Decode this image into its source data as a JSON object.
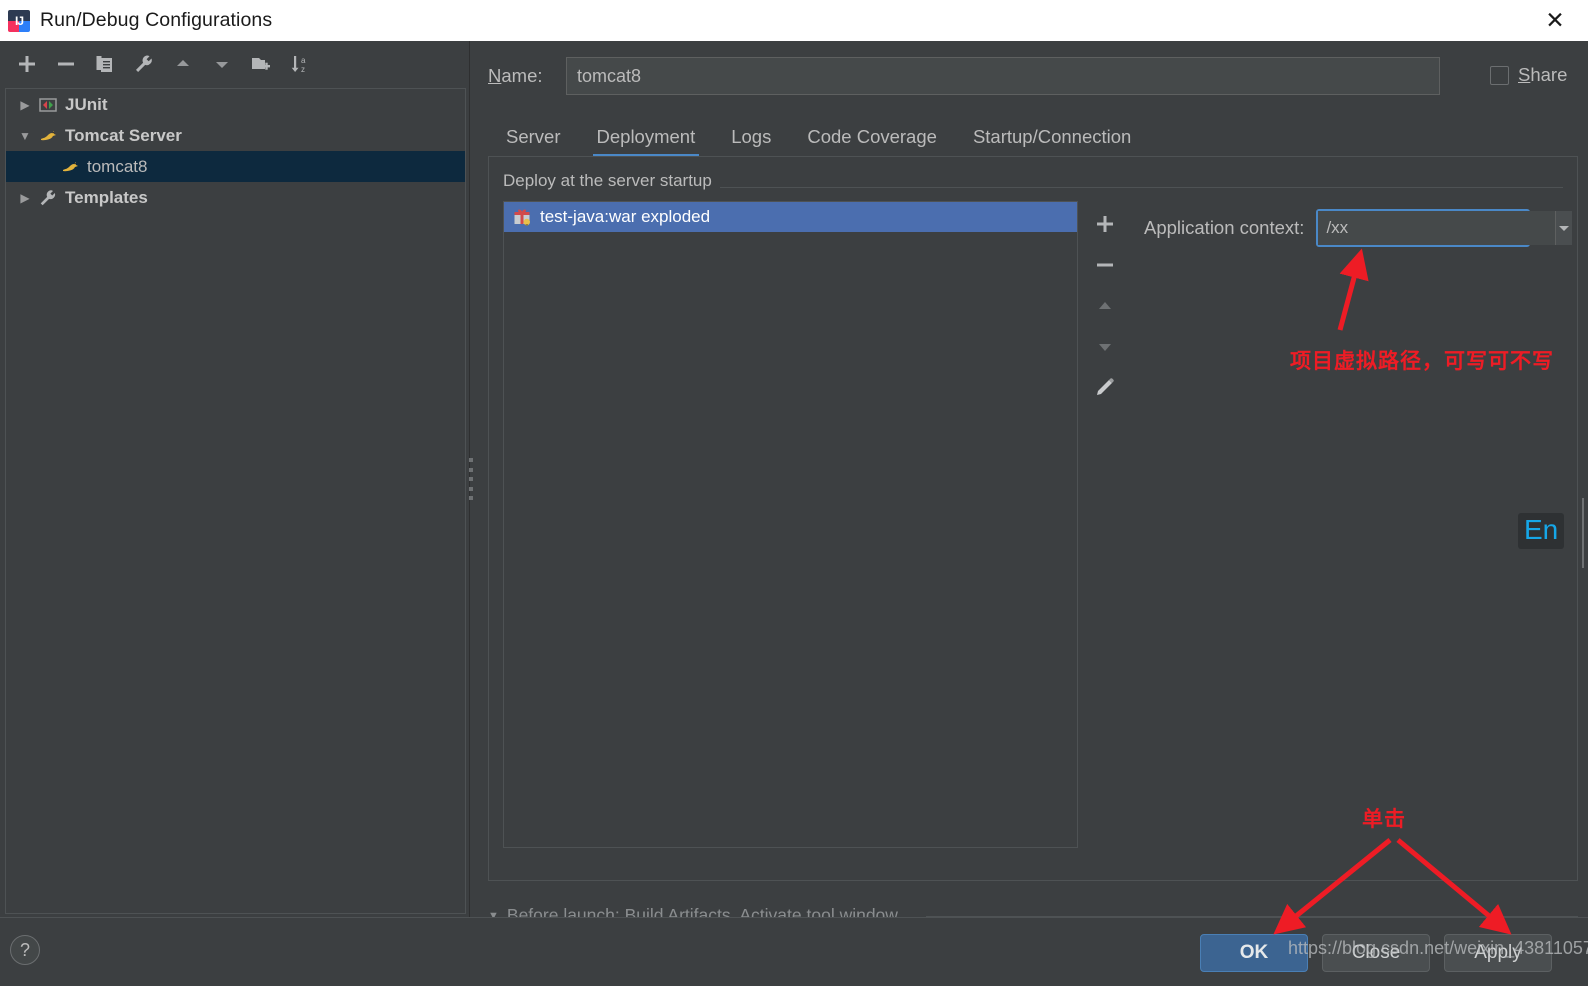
{
  "window": {
    "title": "Run/Debug Configurations",
    "app_icon": "intellij-idea-icon",
    "close_icon": "close-icon"
  },
  "sidebar": {
    "toolbar": [
      {
        "name": "add-configuration-button",
        "icon": "plus-icon"
      },
      {
        "name": "remove-configuration-button",
        "icon": "minus-icon"
      },
      {
        "name": "copy-configuration-button",
        "icon": "copy-icon"
      },
      {
        "name": "edit-templates-button",
        "icon": "wrench-icon"
      },
      {
        "name": "move-up-button",
        "icon": "arrow-up-icon"
      },
      {
        "name": "move-down-button",
        "icon": "arrow-down-icon"
      },
      {
        "name": "create-folder-button",
        "icon": "folder-add-icon"
      },
      {
        "name": "sort-configurations-button",
        "icon": "sort-az-icon"
      }
    ],
    "tree": [
      {
        "label": "JUnit",
        "icon": "junit-icon",
        "expanded": false,
        "indent": 0,
        "selected": false,
        "bold": true
      },
      {
        "label": "Tomcat Server",
        "icon": "tomcat-icon",
        "expanded": true,
        "indent": 0,
        "selected": false,
        "bold": true
      },
      {
        "label": "tomcat8",
        "icon": "tomcat-icon",
        "expanded": null,
        "indent": 1,
        "selected": true,
        "bold": false
      },
      {
        "label": "Templates",
        "icon": "wrench-icon",
        "expanded": false,
        "indent": 0,
        "selected": false,
        "bold": true
      }
    ]
  },
  "main": {
    "name_label": "Name:",
    "name_value": "tomcat8",
    "name_placeholder": "",
    "share_label": "Share",
    "share_checked": false,
    "tabs": [
      {
        "label": "Server",
        "active": false
      },
      {
        "label": "Deployment",
        "active": true
      },
      {
        "label": "Logs",
        "active": false
      },
      {
        "label": "Code Coverage",
        "active": false
      },
      {
        "label": "Startup/Connection",
        "active": false
      }
    ],
    "deployment": {
      "group_title": "Deploy at the server startup",
      "items": [
        {
          "label": "test-java:war exploded",
          "icon": "artifact-icon",
          "selected": true
        }
      ],
      "list_controls": [
        {
          "name": "add-artifact-button",
          "icon": "plus-icon",
          "enabled": true
        },
        {
          "name": "remove-artifact-button",
          "icon": "minus-icon",
          "enabled": true
        },
        {
          "name": "move-artifact-up-button",
          "icon": "arrow-up-icon",
          "enabled": false
        },
        {
          "name": "move-artifact-down-button",
          "icon": "arrow-down-icon",
          "enabled": false
        },
        {
          "name": "edit-artifact-button",
          "icon": "pencil-icon",
          "enabled": true
        }
      ],
      "context_label": "Application context:",
      "context_value": "/xx",
      "context_placeholder": "",
      "context_dropdown_icon": "chevron-down-icon"
    },
    "before_launch": {
      "toggle_icon": "triangle-down-icon",
      "text": "Before launch: Build Artifacts, Activate tool window"
    }
  },
  "bottom": {
    "help_label": "?",
    "buttons": [
      {
        "label": "OK",
        "name": "ok-button",
        "primary": true
      },
      {
        "label": "Close",
        "name": "close-button",
        "primary": false
      },
      {
        "label": "Apply",
        "name": "apply-button",
        "primary": false
      }
    ]
  },
  "annotations": {
    "context_note": "项目虚拟路径，可写可不写",
    "click_note": "单击",
    "color": "#ee1c25"
  },
  "watermark": "https://blog.csdn.net/weixin_43811057",
  "ime_indicator": "En",
  "colors": {
    "window_bg": "#3c3f41",
    "titlebar_bg": "#ffffff",
    "selection_blue": "#4b6eaf",
    "tree_selection": "#0d293e",
    "tab_underline": "#4a88c7",
    "focus_border": "#4a88c7",
    "primary_button": "#3c6491",
    "text": "#bbbbbb",
    "ime_blue": "#16a7e8"
  }
}
